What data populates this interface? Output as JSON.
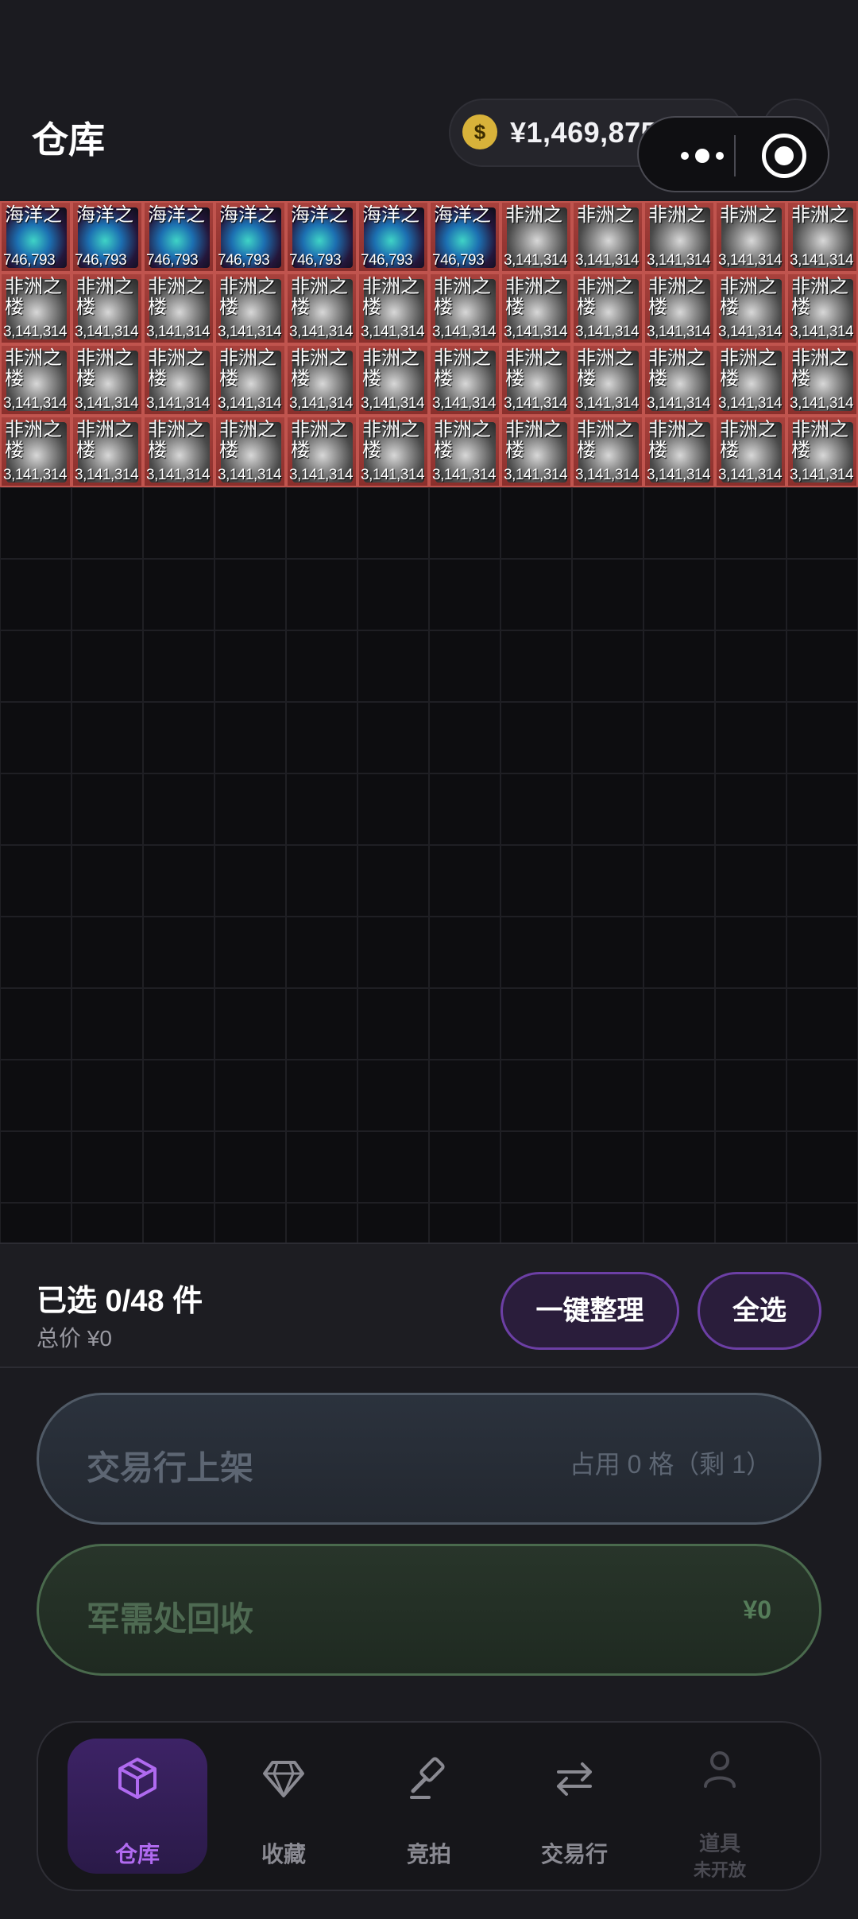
{
  "header": {
    "title": "仓库",
    "balance": "¥1,469,875,696",
    "coin_symbol": "$",
    "add_symbol": "+"
  },
  "grid": {
    "columns": 12,
    "total_rows": 22,
    "items": [
      {
        "type": "ocean",
        "name": "海洋之",
        "price": "746,793"
      },
      {
        "type": "ocean",
        "name": "海洋之",
        "price": "746,793"
      },
      {
        "type": "ocean",
        "name": "海洋之",
        "price": "746,793"
      },
      {
        "type": "ocean",
        "name": "海洋之",
        "price": "746,793"
      },
      {
        "type": "ocean",
        "name": "海洋之",
        "price": "746,793"
      },
      {
        "type": "ocean",
        "name": "海洋之",
        "price": "746,793"
      },
      {
        "type": "ocean",
        "name": "海洋之",
        "price": "746,793"
      },
      {
        "type": "africa",
        "name": "非洲之",
        "price": "3,141,314"
      },
      {
        "type": "africa",
        "name": "非洲之",
        "price": "3,141,314"
      },
      {
        "type": "africa",
        "name": "非洲之",
        "price": "3,141,314"
      },
      {
        "type": "africa",
        "name": "非洲之",
        "price": "3,141,314"
      },
      {
        "type": "africa",
        "name": "非洲之",
        "price": "3,141,314"
      },
      {
        "type": "africa",
        "name": "非洲之楼",
        "price": "3,141,314"
      },
      {
        "type": "africa",
        "name": "非洲之楼",
        "price": "3,141,314"
      },
      {
        "type": "africa",
        "name": "非洲之楼",
        "price": "3,141,314"
      },
      {
        "type": "africa",
        "name": "非洲之楼",
        "price": "3,141,314"
      },
      {
        "type": "africa",
        "name": "非洲之楼",
        "price": "3,141,314"
      },
      {
        "type": "africa",
        "name": "非洲之楼",
        "price": "3,141,314"
      },
      {
        "type": "africa",
        "name": "非洲之楼",
        "price": "3,141,314"
      },
      {
        "type": "africa",
        "name": "非洲之楼",
        "price": "3,141,314"
      },
      {
        "type": "africa",
        "name": "非洲之楼",
        "price": "3,141,314"
      },
      {
        "type": "africa",
        "name": "非洲之楼",
        "price": "3,141,314"
      },
      {
        "type": "africa",
        "name": "非洲之楼",
        "price": "3,141,314"
      },
      {
        "type": "africa",
        "name": "非洲之楼",
        "price": "3,141,314"
      },
      {
        "type": "africa",
        "name": "非洲之楼",
        "price": "3,141,314"
      },
      {
        "type": "africa",
        "name": "非洲之楼",
        "price": "3,141,314"
      },
      {
        "type": "africa",
        "name": "非洲之楼",
        "price": "3,141,314"
      },
      {
        "type": "africa",
        "name": "非洲之楼",
        "price": "3,141,314"
      },
      {
        "type": "africa",
        "name": "非洲之楼",
        "price": "3,141,314"
      },
      {
        "type": "africa",
        "name": "非洲之楼",
        "price": "3,141,314"
      },
      {
        "type": "africa",
        "name": "非洲之楼",
        "price": "3,141,314"
      },
      {
        "type": "africa",
        "name": "非洲之楼",
        "price": "3,141,314"
      },
      {
        "type": "africa",
        "name": "非洲之楼",
        "price": "3,141,314"
      },
      {
        "type": "africa",
        "name": "非洲之楼",
        "price": "3,141,314"
      },
      {
        "type": "africa",
        "name": "非洲之楼",
        "price": "3,141,314"
      },
      {
        "type": "africa",
        "name": "非洲之楼",
        "price": "3,141,314"
      },
      {
        "type": "africa",
        "name": "非洲之楼",
        "price": "3,141,314"
      },
      {
        "type": "africa",
        "name": "非洲之楼",
        "price": "3,141,314"
      },
      {
        "type": "africa",
        "name": "非洲之楼",
        "price": "3,141,314"
      },
      {
        "type": "africa",
        "name": "非洲之楼",
        "price": "3,141,314"
      },
      {
        "type": "africa",
        "name": "非洲之楼",
        "price": "3,141,314"
      },
      {
        "type": "africa",
        "name": "非洲之楼",
        "price": "3,141,314"
      },
      {
        "type": "africa",
        "name": "非洲之楼",
        "price": "3,141,314"
      },
      {
        "type": "africa",
        "name": "非洲之楼",
        "price": "3,141,314"
      },
      {
        "type": "africa",
        "name": "非洲之楼",
        "price": "3,141,314"
      },
      {
        "type": "africa",
        "name": "非洲之楼",
        "price": "3,141,314"
      },
      {
        "type": "africa",
        "name": "非洲之楼",
        "price": "3,141,314"
      },
      {
        "type": "africa",
        "name": "非洲之楼",
        "price": "3,141,314"
      }
    ]
  },
  "selection": {
    "count_label": "已选 0/48 件",
    "total_label": "总价 ¥0",
    "sort_button": "一键整理",
    "select_all_button": "全选"
  },
  "actions": {
    "market_label": "交易行上架",
    "market_info": "占用 0 格（剩 1）",
    "recycle_label": "军需处回收",
    "recycle_value": "¥0"
  },
  "tabs": [
    {
      "label": "仓库",
      "icon": "box-icon"
    },
    {
      "label": "收藏",
      "icon": "diamond-icon"
    },
    {
      "label": "竞拍",
      "icon": "gavel-icon"
    },
    {
      "label": "交易行",
      "icon": "swap-icon"
    },
    {
      "label": "道具",
      "sub": "未开放",
      "icon": "user-icon"
    }
  ],
  "colors": {
    "accent_purple": "#b06af0",
    "item_red": "#a8413c",
    "coin_gold": "#d8b23a"
  }
}
